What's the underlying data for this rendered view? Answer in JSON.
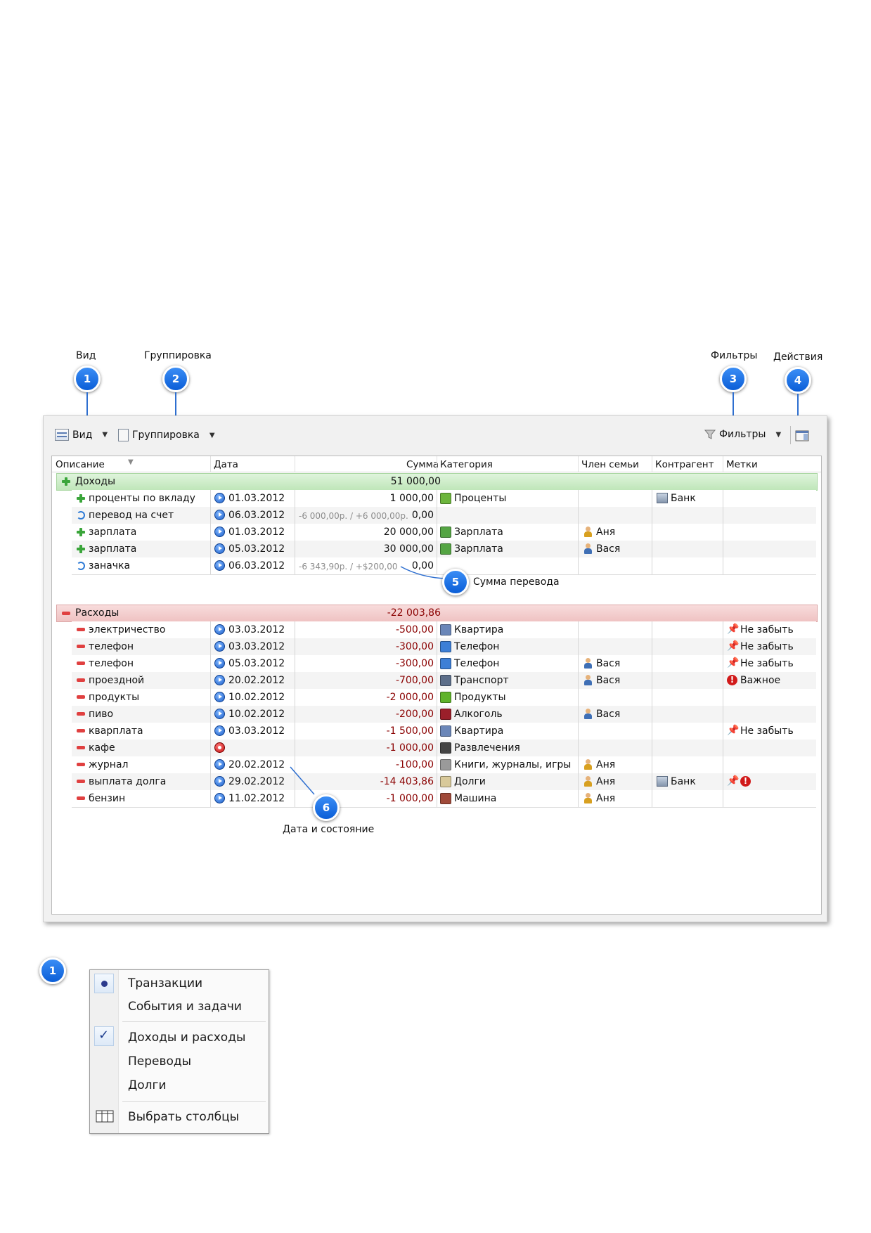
{
  "callouts": {
    "top_labels": {
      "vid": "Вид",
      "gruppirovka": "Группировка",
      "filtry": "Фильтры",
      "deystviya": "Действия"
    },
    "numbers": [
      "1",
      "2",
      "3",
      "4",
      "5",
      "6"
    ],
    "summa_perevoda": "Сумма перевода",
    "data_i_sostoyanie": "Дата и состояние"
  },
  "toolbar": {
    "view_label": "Вид",
    "grouping_label": "Группировка",
    "filters_label": "Фильтры"
  },
  "columns": [
    "Описание",
    "Дата",
    "Сумма",
    "Категория",
    "Член семьи",
    "Контрагент",
    "Метки"
  ],
  "income_group": {
    "label": "Доходы",
    "sum": "51 000,00"
  },
  "income_rows": [
    {
      "type": "plus",
      "desc": "проценты по вкладу",
      "date": "01.03.2012",
      "amount": "1 000,00",
      "transfer": "",
      "category": "Проценты",
      "cat_icon": "percent-icon",
      "member": "",
      "counterparty": "Банк",
      "tags": []
    },
    {
      "type": "transfer",
      "desc": "перевод на счет",
      "date": "06.03.2012",
      "amount": "0,00",
      "transfer": "-6 000,00р. / +6 000,00р.",
      "category": "",
      "cat_icon": "",
      "member": "",
      "counterparty": "",
      "tags": []
    },
    {
      "type": "plus",
      "desc": "зарплата",
      "date": "01.03.2012",
      "amount": "20 000,00",
      "transfer": "",
      "category": "Зарплата",
      "cat_icon": "salary-icon",
      "member": "Аня",
      "counterparty": "",
      "tags": []
    },
    {
      "type": "plus",
      "desc": "зарплата",
      "date": "05.03.2012",
      "amount": "30 000,00",
      "transfer": "",
      "category": "Зарплата",
      "cat_icon": "salary-icon",
      "member": "Вася",
      "counterparty": "",
      "tags": []
    },
    {
      "type": "transfer",
      "desc": "заначка",
      "date": "06.03.2012",
      "amount": "0,00",
      "transfer": "-6 343,90р. / +$200,00",
      "category": "",
      "cat_icon": "",
      "member": "",
      "counterparty": "",
      "tags": []
    }
  ],
  "expense_group": {
    "label": "Расходы",
    "sum": "-22 003,86"
  },
  "expense_rows": [
    {
      "desc": "электричество",
      "date": "03.03.2012",
      "status": "play",
      "amount": "-500,00",
      "category": "Квартира",
      "member": "",
      "counterparty": "",
      "tag": "Не забыть",
      "tag_icon": "pin"
    },
    {
      "desc": "телефон",
      "date": "03.03.2012",
      "status": "play",
      "amount": "-300,00",
      "category": "Телефон",
      "member": "",
      "counterparty": "",
      "tag": "Не забыть",
      "tag_icon": "pin"
    },
    {
      "desc": "телефон",
      "date": "05.03.2012",
      "status": "play",
      "amount": "-300,00",
      "category": "Телефон",
      "member": "Вася",
      "counterparty": "",
      "tag": "Не забыть",
      "tag_icon": "pin"
    },
    {
      "desc": "проездной",
      "date": "20.02.2012",
      "status": "play",
      "amount": "-700,00",
      "category": "Транспорт",
      "member": "Вася",
      "counterparty": "",
      "tag": "Важное",
      "tag_icon": "important"
    },
    {
      "desc": "продукты",
      "date": "10.02.2012",
      "status": "play",
      "amount": "-2 000,00",
      "category": "Продукты",
      "member": "",
      "counterparty": "",
      "tag": "",
      "tag_icon": ""
    },
    {
      "desc": "пиво",
      "date": "10.02.2012",
      "status": "play",
      "amount": "-200,00",
      "category": "Алкоголь",
      "member": "Вася",
      "counterparty": "",
      "tag": "",
      "tag_icon": ""
    },
    {
      "desc": "кварплата",
      "date": "03.03.2012",
      "status": "play",
      "amount": "-1 500,00",
      "category": "Квартира",
      "member": "",
      "counterparty": "",
      "tag": "Не забыть",
      "tag_icon": "pin"
    },
    {
      "desc": "кафе",
      "date": "",
      "status": "stop",
      "amount": "-1 000,00",
      "category": "Развлечения",
      "member": "",
      "counterparty": "",
      "tag": "",
      "tag_icon": ""
    },
    {
      "desc": "журнал",
      "date": "20.02.2012",
      "status": "play",
      "amount": "-100,00",
      "category": "Книги, журналы, игры",
      "member": "Аня",
      "counterparty": "",
      "tag": "",
      "tag_icon": ""
    },
    {
      "desc": "выплата долга",
      "date": "29.02.2012",
      "status": "play",
      "amount": "-14 403,86",
      "category": "Долги",
      "member": "Аня",
      "counterparty": "Банк",
      "tag": "",
      "tag_icon": "pin+important"
    },
    {
      "desc": "бензин",
      "date": "11.02.2012",
      "status": "play",
      "amount": "-1 000,00",
      "category": "Машина",
      "member": "Аня",
      "counterparty": "",
      "tag": "",
      "tag_icon": ""
    }
  ],
  "view_menu": {
    "items": [
      "Транзакции",
      "События и задачи",
      "Доходы и расходы",
      "Переводы",
      "Долги",
      "Выбрать столбцы"
    ],
    "selected_radio": "Транзакции",
    "checked": "Доходы и расходы"
  },
  "colors": {
    "badge": "#1e6fe6",
    "income_group": "#c8ebc3",
    "expense_group": "#f3cfcf",
    "negative": "#8a0000"
  }
}
